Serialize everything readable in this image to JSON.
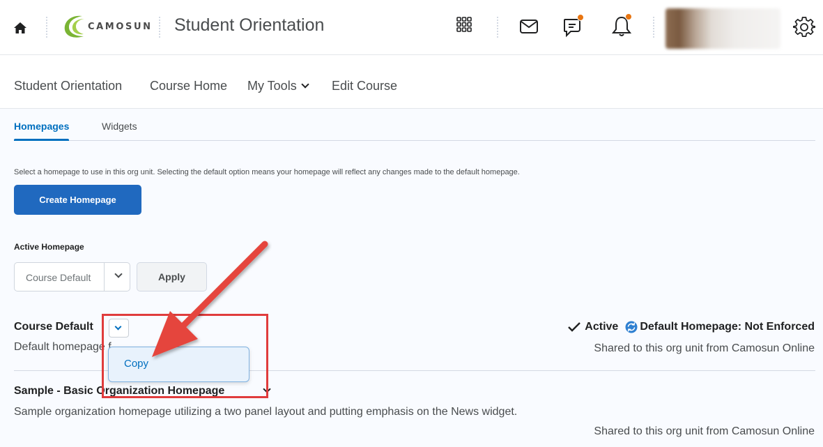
{
  "header": {
    "logo_text": "CAMOSUN",
    "course_title": "Student Orientation",
    "colors": {
      "notification_dot": "#e87511",
      "logo_green": "#7ab434"
    }
  },
  "nav": {
    "student_orientation": "Student Orientation",
    "course_home": "Course Home",
    "my_tools": "My Tools",
    "edit_course": "Edit Course"
  },
  "tabs": {
    "homepages": "Homepages",
    "widgets": "Widgets",
    "active": "Homepages"
  },
  "intro_text": "Select a homepage to use in this org unit. Selecting the default option means your homepage will reflect any changes made to the default homepage.",
  "create_button": "Create Homepage",
  "active_homepage": {
    "label": "Active Homepage",
    "selected": "Course Default",
    "apply": "Apply"
  },
  "homepages": [
    {
      "title": "Course Default",
      "description": "Default homepage f",
      "status_active": "Active",
      "status_default": "Default Homepage: Not Enforced",
      "shared": "Shared to this org unit from Camosun Online"
    },
    {
      "title": "Sample - Basic Organization Homepage",
      "description": "Sample organization homepage utilizing a two panel layout and putting emphasis on the News widget.",
      "shared": "Shared to this org unit from Camosun Online"
    }
  ],
  "context_menu": {
    "copy": "Copy"
  },
  "colors": {
    "primary": "#2069bf",
    "link": "#006fbf",
    "annotation": "#e03c3c"
  }
}
